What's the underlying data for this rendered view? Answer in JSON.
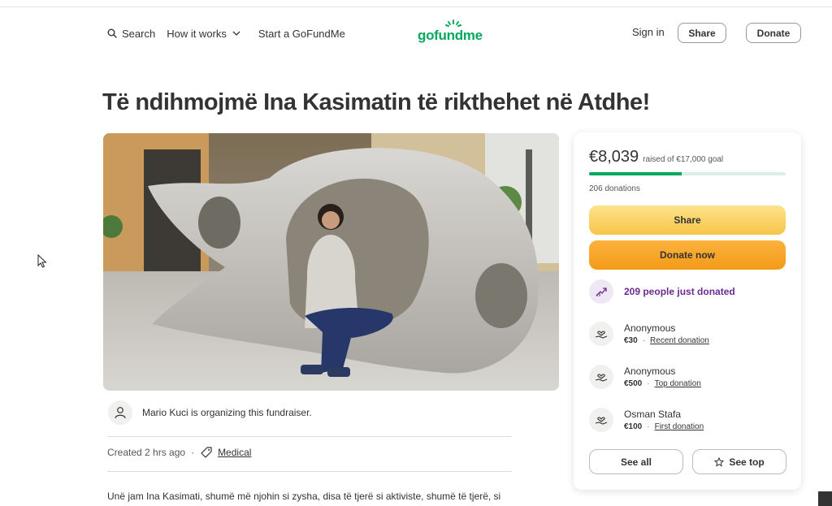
{
  "header": {
    "search_label": "Search",
    "how_it_works_label": "How it works",
    "start_label": "Start a GoFundMe",
    "logo_text": "gofundme",
    "signin_label": "Sign in",
    "share_label": "Share",
    "donate_label": "Donate"
  },
  "campaign": {
    "title": "Të ndihmojmë Ina Kasimatin të rikthehet në Atdhe!",
    "organizer_text": "Mario Kuci is organizing this fundraiser.",
    "created": "Created 2 hrs ago",
    "dot": "·",
    "category": "Medical",
    "story": "Unë jam Ina Kasimati, shumë më njohin si zysha, disa të tjerë si aktiviste, shumë të tjerë, si"
  },
  "card": {
    "raised_amount": "€8,039",
    "goal_text": "raised of €17,000 goal",
    "progress": 0.473,
    "donations_count": "206 donations",
    "share_label": "Share",
    "donate_label": "Donate now",
    "trending_text": "209 people just donated",
    "donors": [
      {
        "name": "Anonymous",
        "amount": "€30",
        "tag": "Recent donation"
      },
      {
        "name": "Anonymous",
        "amount": "€500",
        "tag": "Top donation"
      },
      {
        "name": "Osman Stafa",
        "amount": "€100",
        "tag": "First donation"
      }
    ],
    "see_all_label": "See all",
    "see_top_label": "See top"
  },
  "colors": {
    "brand_green": "#02a95c",
    "share_yellow": "#f7c548",
    "donate_orange": "#f39b18",
    "trend_purple": "#6b2a8f"
  },
  "icons": [
    "search-icon",
    "chevron-down-icon",
    "sun-logo-icon",
    "user-icon",
    "tag-icon",
    "trending-up-icon",
    "heart-hand-icon",
    "star-icon",
    "cursor-icon"
  ]
}
